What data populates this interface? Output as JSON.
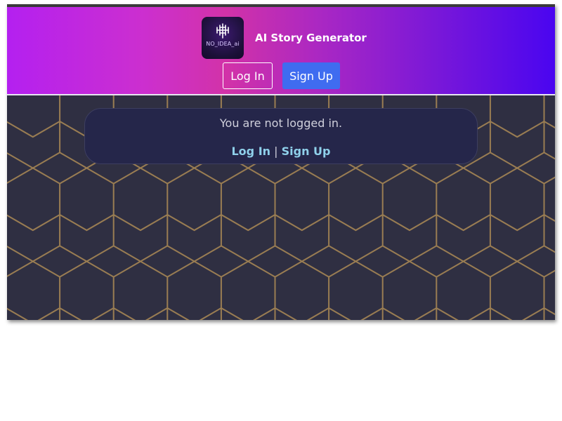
{
  "app": {
    "title": "AI Story Generator",
    "logo_text": "NO_IDEA_ai",
    "logo_icon": "circuit-tree-icon"
  },
  "header": {
    "login_label": "Log In",
    "signup_label": "Sign Up"
  },
  "notice": {
    "message": "You are not logged in.",
    "login_link": "Log In",
    "separator": "|",
    "signup_link": "Sign Up"
  },
  "colors": {
    "gradient_start": "#b420f0",
    "gradient_mid": "#d232a8",
    "gradient_end": "#4a05f0",
    "signup_button": "#3f6cf0",
    "page_background": "#2f2f42",
    "hex_lines": "#9a7d52",
    "notice_background": "#25264a",
    "link_color": "#8fd0ea"
  }
}
